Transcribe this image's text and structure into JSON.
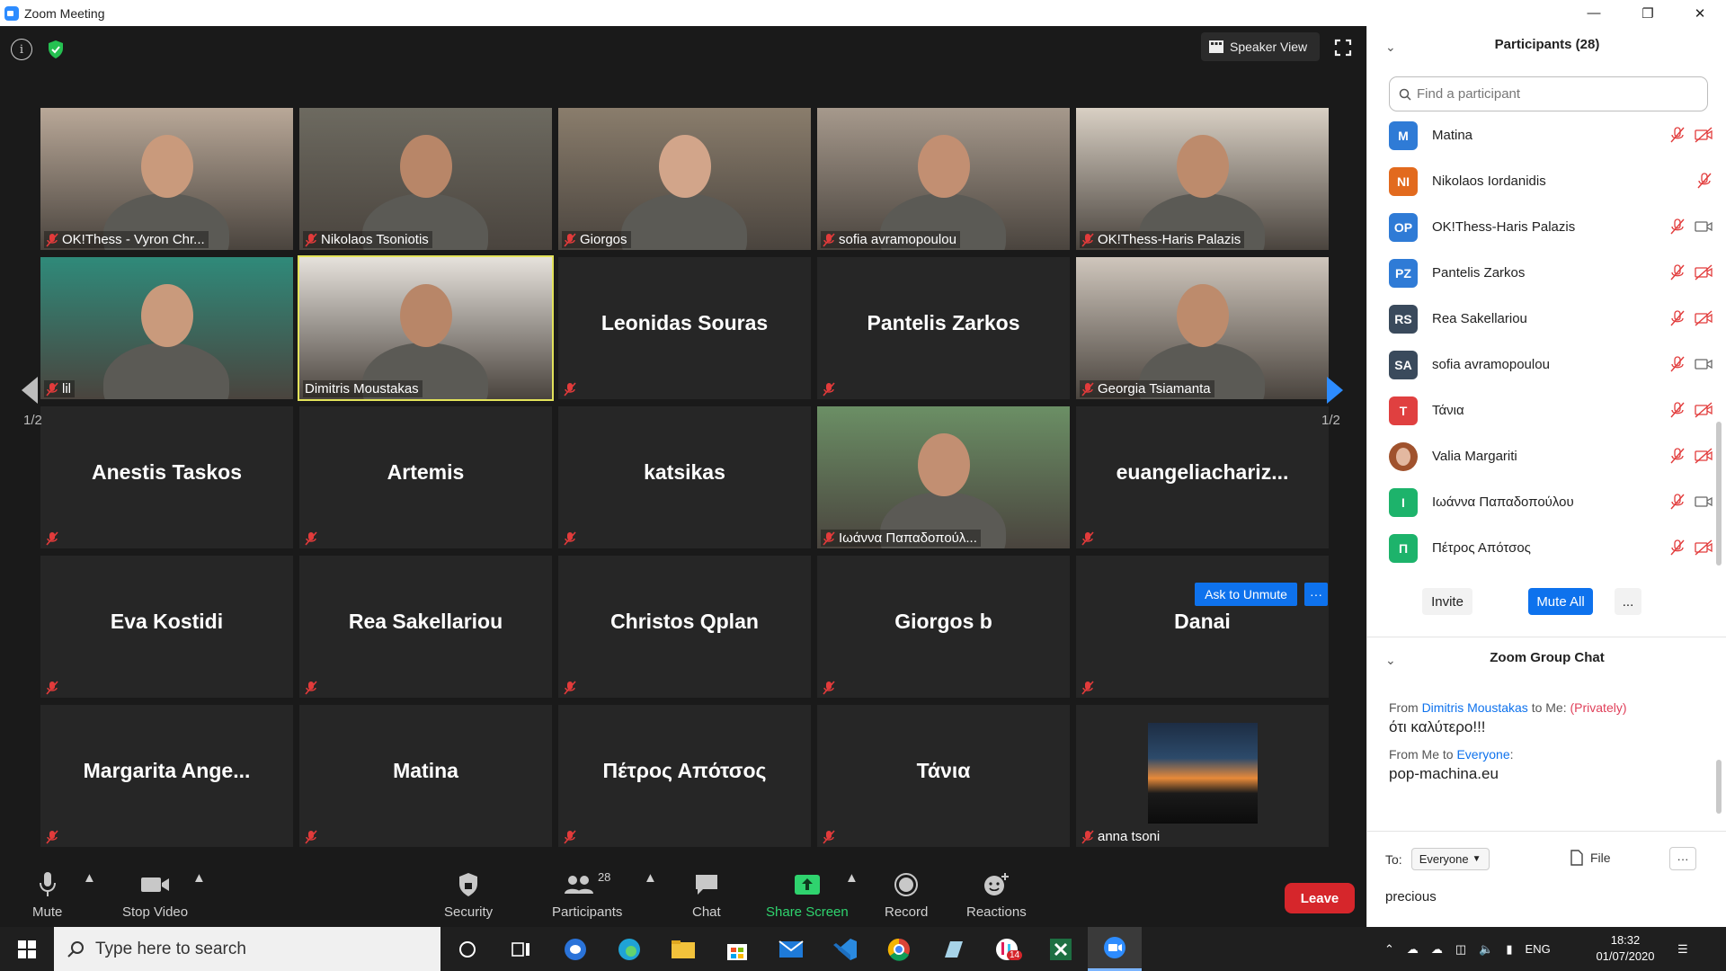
{
  "window": {
    "title": "Zoom Meeting"
  },
  "header": {
    "speaker_view_label": "Speaker View"
  },
  "gallery": {
    "page_indicator": "1/2",
    "ask_to_unmute_label": "Ask to Unmute",
    "tiles": [
      {
        "name": "OK!Thess - Vyron Chr...",
        "video": true
      },
      {
        "name": "Nikolaos Tsoniotis",
        "video": true
      },
      {
        "name": "Giorgos",
        "video": true
      },
      {
        "name": "sofia avramopoulou",
        "video": true
      },
      {
        "name": "OK!Thess-Haris Palazis",
        "video": true
      },
      {
        "name": "lil",
        "video": true
      },
      {
        "name": "Dimitris Moustakas",
        "video": true,
        "active": true
      },
      {
        "name": "Leonidas Souras",
        "video": false
      },
      {
        "name": "Pantelis Zarkos",
        "video": false
      },
      {
        "name": "Georgia Tsiamanta",
        "video": true
      },
      {
        "name": "Anestis Taskos",
        "video": false
      },
      {
        "name": "Artemis",
        "video": false
      },
      {
        "name": "katsikas",
        "video": false
      },
      {
        "name": "Ιωάννα Παπαδοπούλ...",
        "video": true
      },
      {
        "name": "euangeliachariz...",
        "video": false
      },
      {
        "name": "Eva Kostidi",
        "video": false
      },
      {
        "name": "Rea Sakellariou",
        "video": false
      },
      {
        "name": "Christos Qplan",
        "video": false
      },
      {
        "name": "Giorgos b",
        "video": false
      },
      {
        "name": "Danai",
        "video": false
      },
      {
        "name": "Margarita  Ange...",
        "video": false
      },
      {
        "name": "Matina",
        "video": false
      },
      {
        "name": "Πέτρος Απότσος",
        "video": false
      },
      {
        "name": "Τάνια",
        "video": false
      },
      {
        "name": "anna tsoni",
        "video": false,
        "picture": true
      }
    ]
  },
  "toolbar": {
    "mute": "Mute",
    "stop_video": "Stop Video",
    "security": "Security",
    "participants": "Participants",
    "participants_count": "28",
    "chat": "Chat",
    "share_screen": "Share Screen",
    "record": "Record",
    "reactions": "Reactions",
    "leave": "Leave"
  },
  "participants_panel": {
    "title": "Participants (28)",
    "search_placeholder": "Find a participant",
    "people": [
      {
        "initials": "M",
        "name": "Matina",
        "color": "#2f7bd6",
        "video": "off"
      },
      {
        "initials": "NI",
        "name": "Nikolaos Iordanidis",
        "color": "#e26a1e",
        "video": "none"
      },
      {
        "initials": "OP",
        "name": "OK!Thess-Haris Palazis",
        "color": "#2f7bd6",
        "video": "on"
      },
      {
        "initials": "PZ",
        "name": "Pantelis Zarkos",
        "color": "#2f7bd6",
        "video": "off"
      },
      {
        "initials": "RS",
        "name": "Rea Sakellariou",
        "color": "#3a4a5c",
        "video": "off"
      },
      {
        "initials": "SA",
        "name": "sofia avramopoulou",
        "color": "#3a4a5c",
        "video": "on"
      },
      {
        "initials": "T",
        "name": "Τάνια",
        "color": "#e04040",
        "video": "off"
      },
      {
        "initials": "",
        "name": "Valia Margariti",
        "color": "#a0522d",
        "video": "off"
      },
      {
        "initials": "Ι",
        "name": "Ιωάννα Παπαδοπούλου",
        "color": "#1db36b",
        "video": "on"
      },
      {
        "initials": "Π",
        "name": "Πέτρος Απότσος",
        "color": "#1db36b",
        "video": "off"
      }
    ],
    "invite": "Invite",
    "mute_all": "Mute All",
    "more": "..."
  },
  "chat": {
    "title": "Zoom Group Chat",
    "messages": [
      {
        "from_prefix": "From ",
        "from": "Dimitris Moustakas",
        "to_text": " to Me: ",
        "privately": "(Privately)",
        "text": "ότι καλύτερο!!!"
      },
      {
        "from_prefix": "From Me to ",
        "to": "Everyone",
        "suffix": ":",
        "text": "pop-machina.eu"
      }
    ],
    "to_label": "To:",
    "to_value": "Everyone",
    "file_label": "File",
    "more": "···",
    "draft": "precious"
  },
  "taskbar": {
    "search_placeholder": "Type here to search",
    "lang": "ENG",
    "time": "18:32",
    "date": "01/07/2020",
    "badge": "14"
  }
}
